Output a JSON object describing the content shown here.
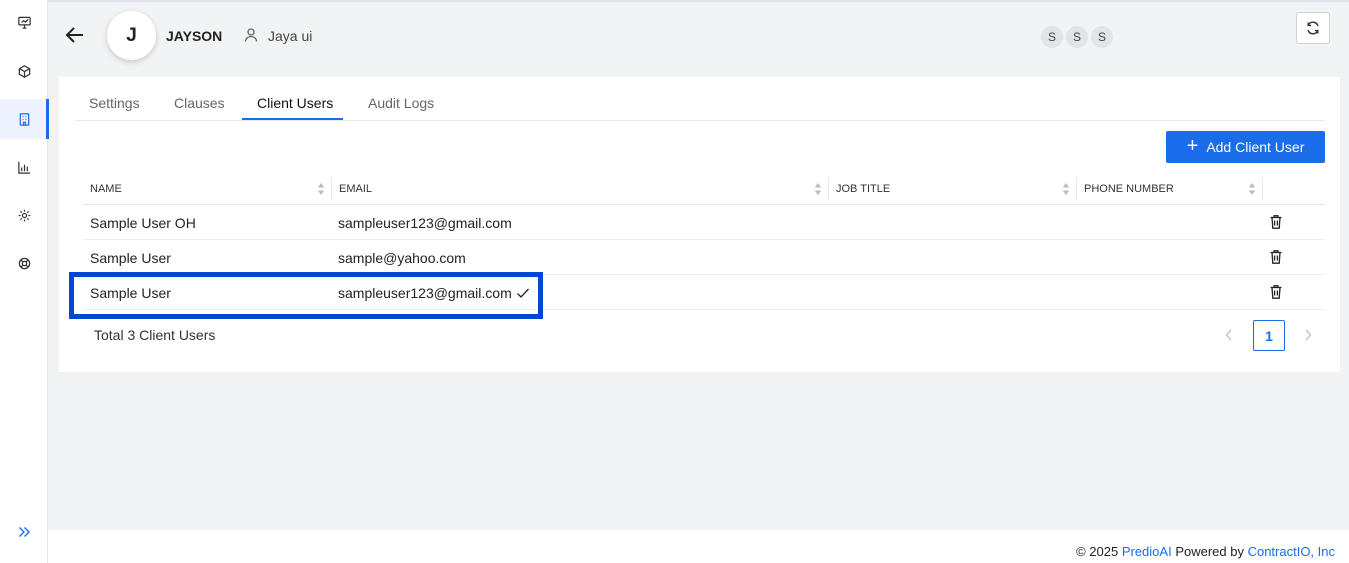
{
  "sidebar": {
    "items": [
      {
        "name": "presentation-icon"
      },
      {
        "name": "cube-icon"
      },
      {
        "name": "building-icon",
        "active": true
      },
      {
        "name": "bar-chart-icon"
      },
      {
        "name": "gear-icon"
      },
      {
        "name": "support-icon"
      }
    ],
    "expand_icon": "double-chevron-right-icon"
  },
  "header": {
    "avatar_initial": "J",
    "client_name": "JAYSON",
    "user_name": "Jaya ui",
    "presence": [
      "S",
      "S",
      "S"
    ]
  },
  "tabs": [
    {
      "label": "Settings"
    },
    {
      "label": "Clauses"
    },
    {
      "label": "Client Users",
      "active": true
    },
    {
      "label": "Audit Logs"
    }
  ],
  "actions": {
    "add_label": "Add Client User"
  },
  "table": {
    "columns": [
      "NAME",
      "EMAIL",
      "JOB TITLE",
      "PHONE NUMBER"
    ],
    "rows": [
      {
        "name": "Sample User OH",
        "email": "sampleuser123@gmail.com",
        "job_title": "",
        "phone": ""
      },
      {
        "name": "Sample User",
        "email": "sample@yahoo.com",
        "job_title": "",
        "phone": ""
      },
      {
        "name": "Sample User",
        "email": "sampleuser123@gmail.com",
        "job_title": "",
        "phone": "",
        "email_verified": true
      }
    ]
  },
  "pagination": {
    "total_text": "Total 3 Client Users",
    "current_page": "1"
  },
  "footer": {
    "prefix": "© 2025 ",
    "brand": "PredioAI",
    "powered": " Powered by ",
    "company": "ContractIO, Inc"
  },
  "colors": {
    "accent": "#1a6ce8",
    "highlight": "#0047d4"
  }
}
